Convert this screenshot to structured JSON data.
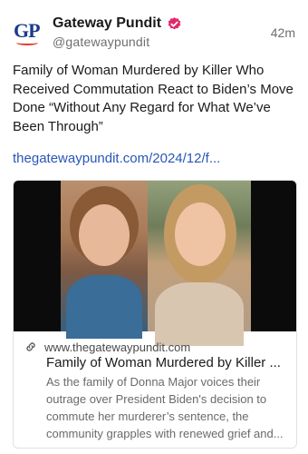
{
  "post": {
    "author_name": "Gateway Pundit",
    "handle": "@gatewaypundit",
    "time": "42m",
    "logo_text": "GP",
    "text": "Family of Woman Murdered by Killer Who Received Commutation React to Biden’s Move Done “Without Any Regard for What We’ve Been Through”",
    "link": "thegatewaypundit.com/2024/12/f..."
  },
  "card": {
    "domain": "www.thegatewaypundit.com",
    "title": "Family of Woman Murdered by Killer ...",
    "description": "As the family of Donna Major voices their outrage over President Biden's decision to commute her murderer’s sentence, the community grapples with renewed grief and..."
  },
  "colors": {
    "link": "#2a56b8",
    "verified_badge": "#e0296b",
    "logo_blue": "#1b3a8c"
  },
  "icons": [
    "verified-badge-icon",
    "link-icon"
  ]
}
